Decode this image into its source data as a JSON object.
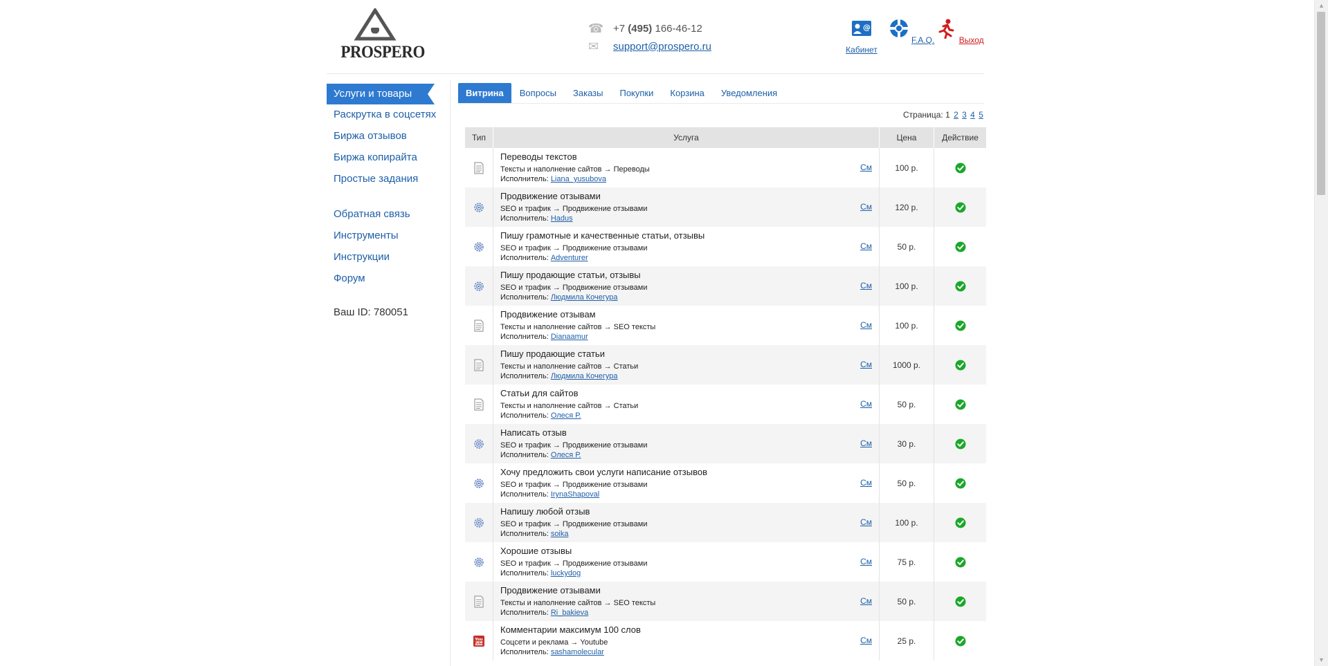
{
  "header": {
    "logo_text": "PROSPERO",
    "phone_prefix": "+7 ",
    "phone_code": "(495)",
    "phone_number": " 166-46-12",
    "email": "support@prospero.ru",
    "buttons": {
      "cabinet": "Кабинет",
      "faq": "F.A.Q.",
      "exit": "Выход"
    }
  },
  "sidebar": {
    "active": "Услуги и товары",
    "items": [
      "Раскрутка в соцсетях",
      "Биржа отзывов",
      "Биржа копирайта",
      "Простые задания"
    ],
    "items2": [
      "Обратная связь",
      "Инструменты",
      "Инструкции",
      "Форум"
    ],
    "user_id": "Ваш ID: 780051"
  },
  "tabs": [
    "Витрина",
    "Вопросы",
    "Заказы",
    "Покупки",
    "Корзина",
    "Уведомления"
  ],
  "pager": {
    "label": "Страница:",
    "current": "1",
    "pages": [
      "2",
      "3",
      "4",
      "5"
    ]
  },
  "table": {
    "headers": {
      "type": "Тип",
      "service": "Услуга",
      "price": "Цена",
      "action": "Действие"
    },
    "exec_label": "Исполнитель:",
    "see_label": "См",
    "rows": [
      {
        "icon": "document-icon",
        "title": "Переводы текстов",
        "cat": "Тексты и наполнение сайтов → Переводы",
        "exec": "Liana_yusubova",
        "price": "100 р."
      },
      {
        "icon": "gear-icon",
        "title": "Продвижение отзывами",
        "cat": "SEO и трафик → Продвижение отзывами",
        "exec": "Hadus",
        "price": "120 р."
      },
      {
        "icon": "gear-icon",
        "title": "Пишу грамотные и качественные статьи, отзывы",
        "cat": "SEO и трафик → Продвижение отзывами",
        "exec": "Adventurer",
        "price": "50 р."
      },
      {
        "icon": "gear-icon",
        "title": "Пишу продающие статьи, отзывы",
        "cat": "SEO и трафик → Продвижение отзывами",
        "exec": "Людмила Кочегура",
        "price": "100 р."
      },
      {
        "icon": "document-icon",
        "title": "Продвижение отзывам",
        "cat": "Тексты и наполнение сайтов → SEO тексты",
        "exec": "Dianaamur",
        "price": "100 р."
      },
      {
        "icon": "document-icon",
        "title": "Пишу продающие статьи",
        "cat": "Тексты и наполнение сайтов → Статьи",
        "exec": "Людмила Кочегура",
        "price": "1000 р."
      },
      {
        "icon": "document-icon",
        "title": "Статьи для сайтов",
        "cat": "Тексты и наполнение сайтов → Статьи",
        "exec": "Олеся Р.",
        "price": "50 р."
      },
      {
        "icon": "gear-icon",
        "title": "Написать отзыв",
        "cat": "SEO и трафик → Продвижение отзывами",
        "exec": "Олеся Р.",
        "price": "30 р."
      },
      {
        "icon": "gear-icon",
        "title": "Хочу предложить свои услуги написание отзывов",
        "cat": "SEO и трафик → Продвижение отзывами",
        "exec": "IrynaShapoval",
        "price": "50 р."
      },
      {
        "icon": "gear-icon",
        "title": "Напишу любой отзыв",
        "cat": "SEO и трафик → Продвижение отзывами",
        "exec": "soika",
        "price": "100 р."
      },
      {
        "icon": "gear-icon",
        "title": "Хорошие отзывы",
        "cat": "SEO и трафик → Продвижение отзывами",
        "exec": "luckydog",
        "price": "75 р."
      },
      {
        "icon": "document-icon",
        "title": "Продвижение отзывами",
        "cat": "Тексты и наполнение сайтов → SEO тексты",
        "exec": "Ri_bakieva",
        "price": "50 р."
      },
      {
        "icon": "youtube-icon",
        "title": "Комментарии максимум 100 слов",
        "cat": "Соцсети и реклама → Youtube",
        "exec": "sashamolecular",
        "price": "25 р."
      }
    ]
  },
  "colors": {
    "accent": "#2e7ad1",
    "link": "#1d5fa8",
    "ok": "#1aa72a",
    "exit": "#d01c1c"
  }
}
